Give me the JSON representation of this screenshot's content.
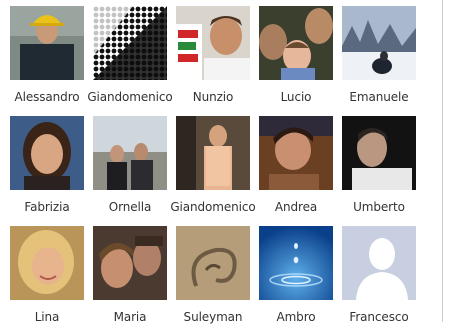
{
  "friends": [
    {
      "name": "Alessandro",
      "photo": "man-in-yellow-hat"
    },
    {
      "name": "Giandomenico",
      "photo": "halftone-graphic"
    },
    {
      "name": "Nunzio",
      "photo": "smiling-man"
    },
    {
      "name": "Lucio",
      "photo": "man-with-child"
    },
    {
      "name": "Emanuele",
      "photo": "snowy-landscape"
    },
    {
      "name": "Fabrizia",
      "photo": "smiling-woman"
    },
    {
      "name": "Ornella",
      "photo": "couple-outdoors"
    },
    {
      "name": "Giandomenico",
      "photo": "man-standing"
    },
    {
      "name": "Andrea",
      "photo": "woman-portrait"
    },
    {
      "name": "Umberto",
      "photo": "man-dark-background"
    },
    {
      "name": "Lina",
      "photo": "blonde-woman"
    },
    {
      "name": "Maria",
      "photo": "couple-selfie"
    },
    {
      "name": "Suleyman",
      "photo": "sculpture-closeup"
    },
    {
      "name": "Ambro",
      "photo": "water-drop"
    },
    {
      "name": "Francesco",
      "photo": "default-silhouette"
    }
  ],
  "colors": {
    "name_text": "#333333",
    "scrollbar_border": "#c8ccd6",
    "silhouette_bg": "#c8cfe0",
    "silhouette_fg": "#ffffff"
  }
}
